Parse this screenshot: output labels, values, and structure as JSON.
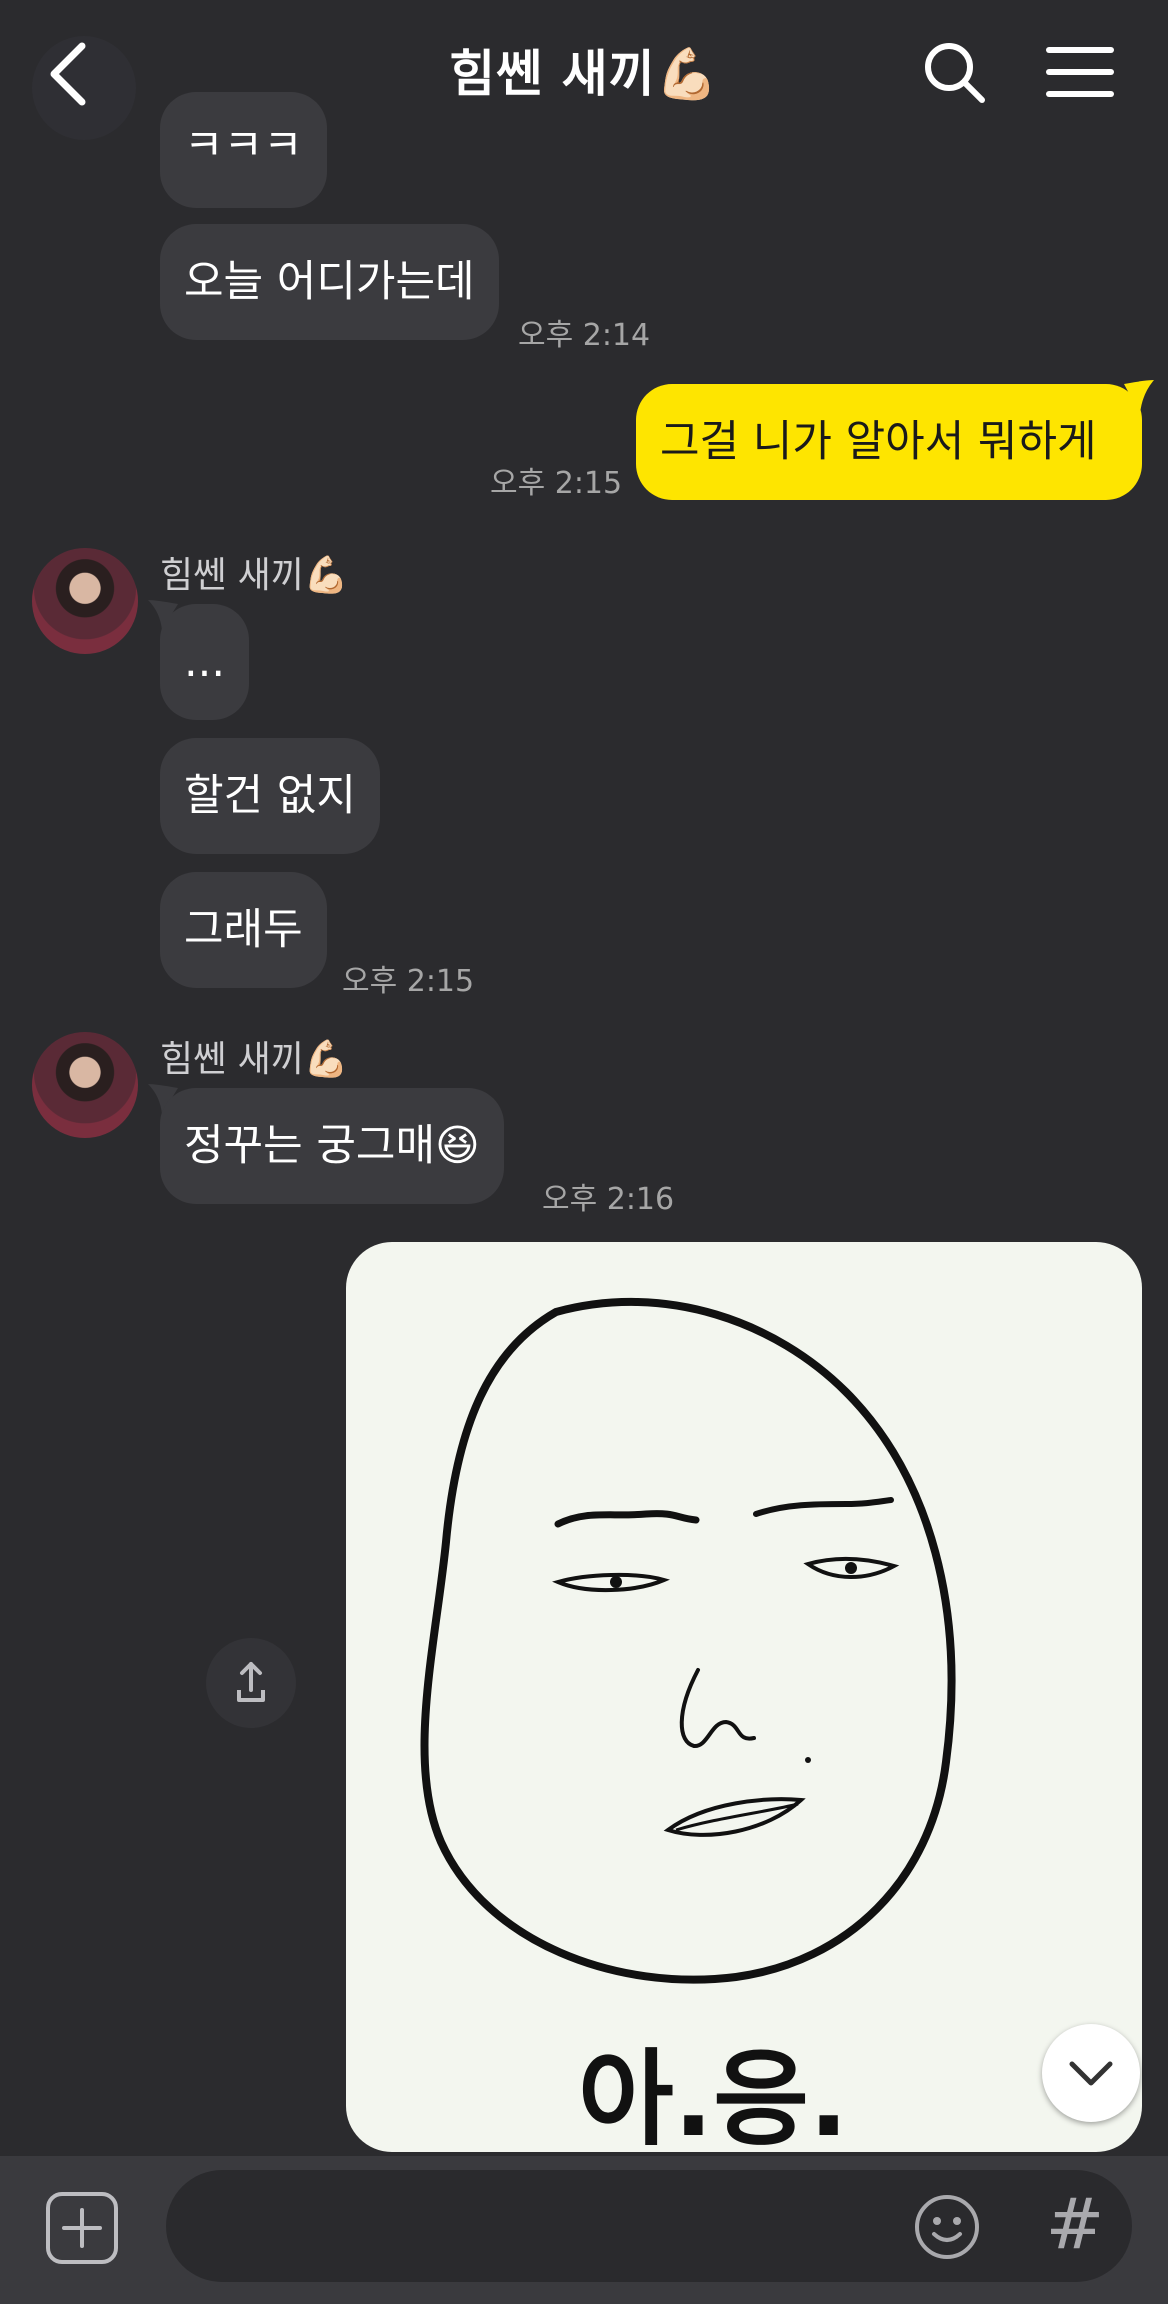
{
  "header": {
    "title": "힘쎈 새끼💪🏻"
  },
  "messages": {
    "m0": {
      "text": "ㅋㅋㅋ"
    },
    "m1": {
      "text": "오늘 어디가는데",
      "time": "오후 2:14"
    },
    "m2": {
      "text": "그걸 니가 알아서 뭐하게",
      "time": "오후 2:15"
    },
    "group2": {
      "sender": "힘쎈 새끼💪🏻",
      "m3": {
        "text": "..."
      },
      "m4": {
        "text": "할건 없지"
      },
      "m5": {
        "text": "그래두",
        "time": "오후 2:15"
      }
    },
    "group3": {
      "sender": "힘쎈 새끼💪🏻",
      "m6": {
        "text": "정꾸는 궁그매😆",
        "time": "오후 2:16"
      }
    },
    "image": {
      "caption": "아.응."
    }
  },
  "composer": {
    "placeholder": ""
  },
  "colors": {
    "background": "#2b2b2e",
    "bubble_other": "#3b3b3f",
    "bubble_me": "#fee500",
    "time_text": "#a6a6a6"
  },
  "icons": {
    "back": "chevron-left-icon",
    "search": "search-icon",
    "menu": "hamburger-menu-icon",
    "share": "share-icon",
    "scroll_down": "chevron-down-icon",
    "attach": "plus-square-icon",
    "emoji": "smiley-icon",
    "hashtag": "hash-icon"
  }
}
